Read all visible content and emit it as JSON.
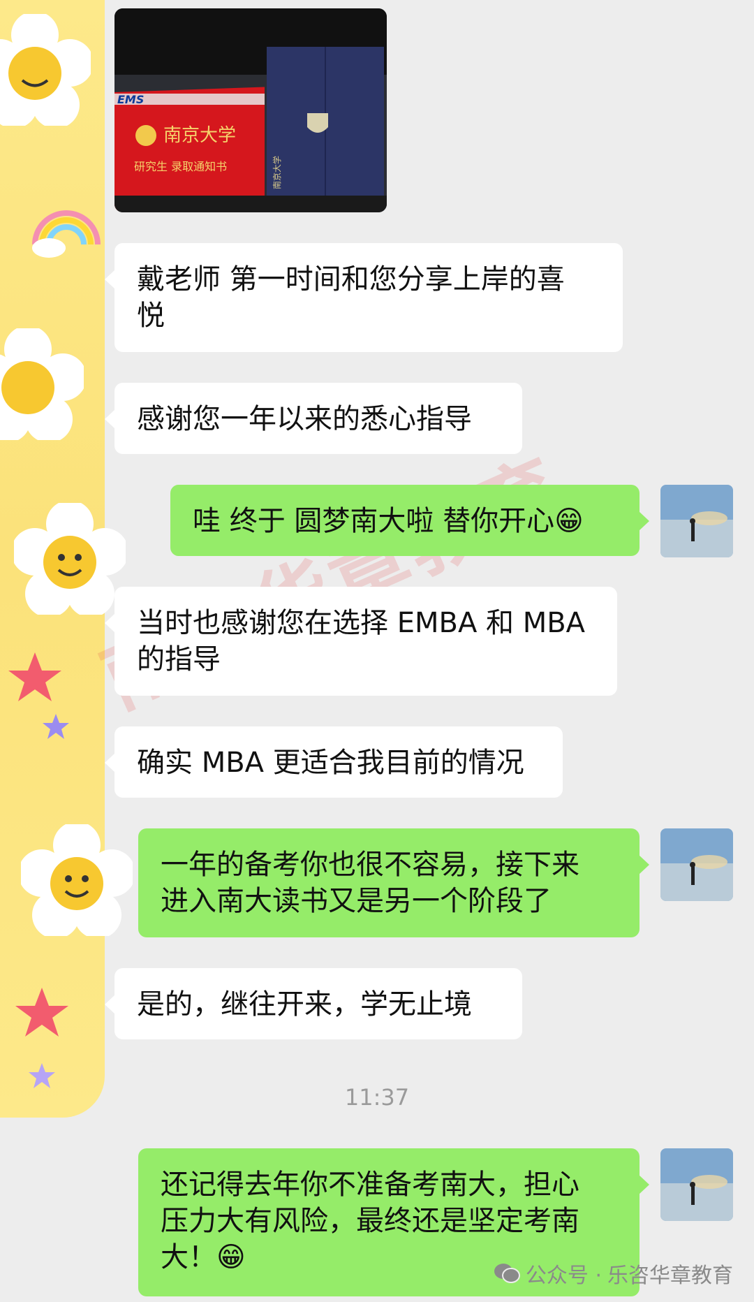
{
  "photo": {
    "envelope_brand": "EMS",
    "letter_title": "南京大学",
    "letter_subtitle": "研究生 录取通知书",
    "folder_title": "南京大学"
  },
  "messages": [
    {
      "side": "in",
      "text": "戴老师 第一时间和您分享上岸的喜\n悦"
    },
    {
      "side": "in",
      "text": "感谢您一年以来的悉心指导"
    },
    {
      "side": "out",
      "text": "哇 终于 圆梦南大啦 替你开心😁"
    },
    {
      "side": "in",
      "text": "当时也感谢您在选择 EMBA 和 MBA\n的指导"
    },
    {
      "side": "in",
      "text": "确实 MBA 更适合我目前的情况"
    },
    {
      "side": "out",
      "text": "一年的备考你也很不容易，接下来\n进入南大读书又是另一个阶段了"
    },
    {
      "side": "in",
      "text": "是的，继往开来，学无止境"
    },
    {
      "side": "out",
      "text": "还记得去年你不准备考南大，担心\n压力大有风险，最终还是坚定考南\n大！😁"
    }
  ],
  "timestamp": "11:37",
  "watermark": "南京华章教育",
  "footer": {
    "prefix": "公众号 · ",
    "account": "乐咨华章教育"
  },
  "colors": {
    "incoming_bubble": "#ffffff",
    "outgoing_bubble": "#95ec69",
    "background": "#ededed"
  }
}
